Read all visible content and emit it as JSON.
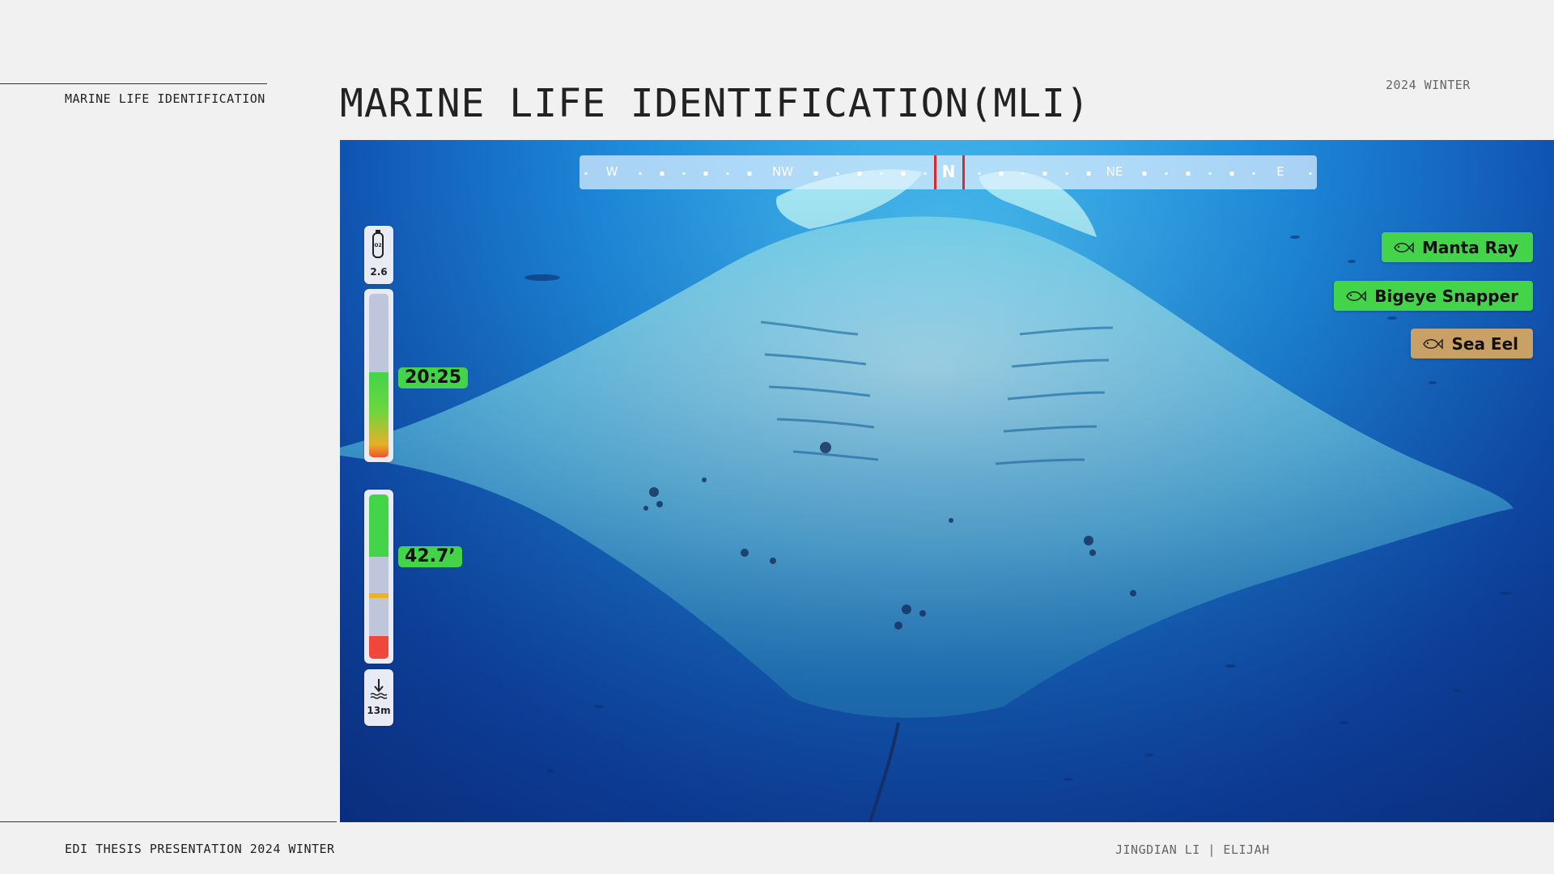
{
  "header": {
    "side_label": "MARINE LIFE IDENTIFICATION",
    "title": "MARINE LIFE IDENTIFICATION(MLI)",
    "season": "2024 WINTER"
  },
  "footer": {
    "left": "EDI THESIS PRESENTATION 2024 WINTER",
    "right": "JINGDIAN LI | ELIJAH"
  },
  "hud": {
    "compass": {
      "labels": [
        "W",
        "NW",
        "N",
        "NE",
        "E"
      ]
    },
    "tank": {
      "icon": "oxygen-tank-icon",
      "value": "2.6"
    },
    "dive_time": {
      "value": "20:25",
      "fill_fraction": 0.52
    },
    "depth": {
      "value": "42.7’",
      "fill_fraction": 0.38
    },
    "max_depth": {
      "icon": "dive-depth-icon",
      "value": "13m"
    }
  },
  "species": [
    {
      "label": "Manta Ray",
      "color": "#44d44a",
      "icon": "fish-icon"
    },
    {
      "label": "Bigeye Snapper",
      "color": "#44d44a",
      "icon": "fish-icon"
    },
    {
      "label": "Sea Eel",
      "color": "#c9a065",
      "icon": "fish-icon"
    }
  ]
}
